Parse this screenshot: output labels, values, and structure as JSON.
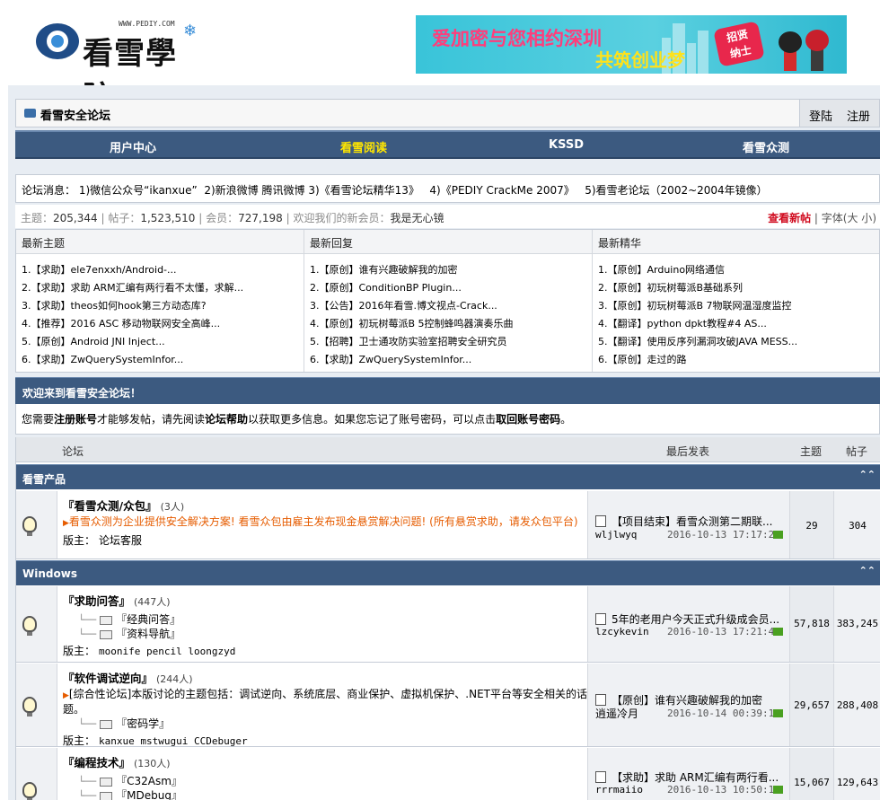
{
  "header": {
    "logo_url_text": "WWW.PEDIY.COM",
    "logo_text": "看雪學院",
    "banner_line1": "爱加密与您相约深圳",
    "banner_line2": "共筑创业梦",
    "banner_badge_line1": "招贤",
    "banner_badge_line2": "纳士"
  },
  "titlebar": {
    "title": "看雪安全论坛",
    "login": "登陆",
    "register": "注册"
  },
  "nav": [
    "用户中心",
    "看雪阅读",
    "KSSD",
    "看雪众测"
  ],
  "nav_active": "看雪阅读",
  "notice": {
    "label": "论坛消息：",
    "items": [
      "1)微信公众号“ikanxue”",
      "2)新浪微博",
      "腾讯微博",
      "3)《看雪论坛精华13》",
      "4)《PEDIY CrackMe 2007》",
      "5)看雪老论坛（2002~2004年镜像）"
    ]
  },
  "stats": {
    "topics_label": "主题：",
    "topics": "205,344",
    "posts_label": "帖子：",
    "posts": "1,523,510",
    "members_label": "会员：",
    "members": "727,198",
    "welcome_label": "欢迎我们的新会员：",
    "newest_member": "我是无心镜",
    "new_posts": "查看新帖",
    "font_label": "字体(",
    "font_large": "大",
    "font_small": "小",
    "font_end": ")"
  },
  "latest": {
    "columns": [
      {
        "header": "最新主题",
        "items": [
          "1.【求助】ele7enxxh/Android-...",
          "2.【求助】求助 ARM汇编有两行看不太懂，求解...",
          "3.【求助】theos如何hook第三方动态库?",
          "4.【推荐】2016 ASC 移动物联网安全高峰...",
          "5.【原创】Android JNI Inject...",
          "6.【求助】ZwQuerySystemInfor..."
        ]
      },
      {
        "header": "最新回复",
        "items": [
          "1.【原创】谁有兴趣破解我的加密",
          "2.【原创】ConditionBP Plugin...",
          "3.【公告】2016年看雪.博文视点-Crack...",
          "4.【原创】初玩树莓派B 5控制蜂鸣器演奏乐曲",
          "5.【招聘】卫士通攻防实验室招聘安全研究员",
          "6.【求助】ZwQuerySystemInfor..."
        ]
      },
      {
        "header": "最新精华",
        "items": [
          "1.【原创】Arduino网络通信",
          "2.【原创】初玩树莓派B基础系列",
          "3.【原创】初玩树莓派B 7物联网温湿度监控",
          "4.【翻译】python dpkt教程#4 AS...",
          "5.【翻译】使用反序列漏洞攻破JAVA MESS...",
          "6.【原创】走过的路"
        ]
      }
    ]
  },
  "welcome": {
    "title": "欢迎来到看雪安全论坛！",
    "t1": "您需要",
    "register_link": "注册账号",
    "t2": "才能够发帖，请先阅读",
    "help_link": "论坛帮助",
    "t3": "以获取更多信息。如果您忘记了账号密码，可以点击",
    "recover_link": "取回账号密码",
    "t4": "。"
  },
  "forum": {
    "headers": {
      "forum": "论坛",
      "last_post": "最后发表",
      "topics": "主题",
      "posts": "帖子"
    },
    "categories": [
      {
        "name": "看雪产品",
        "forums": [
          {
            "name": "『看雪众测/众包』",
            "count": "(3人)",
            "desc": "看雪众测为企业提供安全解决方案! 看雪众包由雇主发布现金悬赏解决问题! (所有悬赏求助，请发众包平台)",
            "mods_label": "版主：",
            "mods": "论坛客服",
            "subforums": [],
            "last_title": "【项目结束】看雪众测第二期联...",
            "last_user": "wljlwyq",
            "last_time": "2016-10-13 17:17:21",
            "topics": "29",
            "posts": "304"
          }
        ]
      },
      {
        "name": "Windows",
        "forums": [
          {
            "name": "『求助问答』",
            "count": "(447人)",
            "desc": "",
            "mods_label": "版主：",
            "mods": "moonife pencil loongzyd",
            "subforums": [
              "『经典问答』",
              "『资料导航』"
            ],
            "last_title": "5年的老用户今天正式升级成会员...",
            "last_user": "lzcykevin",
            "last_time": "2016-10-13 17:21:41",
            "topics": "57,818",
            "posts": "383,245"
          },
          {
            "name": "『软件调试逆向』",
            "count": "(244人)",
            "desc": "[综合性论坛]本版讨论的主题包括：调试逆向、系统底层、商业保护、虚拟机保护、.NET平台等安全相关的话题。",
            "mods_label": "版主：",
            "mods": "kanxue mstwugui CCDebuger",
            "subforums": [
              "『密码学』"
            ],
            "last_title": "【原创】谁有兴趣破解我的加密",
            "last_user": "逍遥冷月",
            "last_time": "2016-10-14 00:39:11",
            "topics": "29,657",
            "posts": "288,408"
          },
          {
            "name": "『编程技术』",
            "count": "(130人)",
            "desc": "",
            "mods_label": "",
            "mods": "",
            "subforums": [
              "『C32Asm』",
              "『MDebug』"
            ],
            "last_title": "【求助】求助 ARM汇编有两行看...",
            "last_user": "rrrmaiio",
            "last_time": "2016-10-13 10:50:17",
            "topics": "15,067",
            "posts": "129,643"
          }
        ]
      }
    ]
  }
}
